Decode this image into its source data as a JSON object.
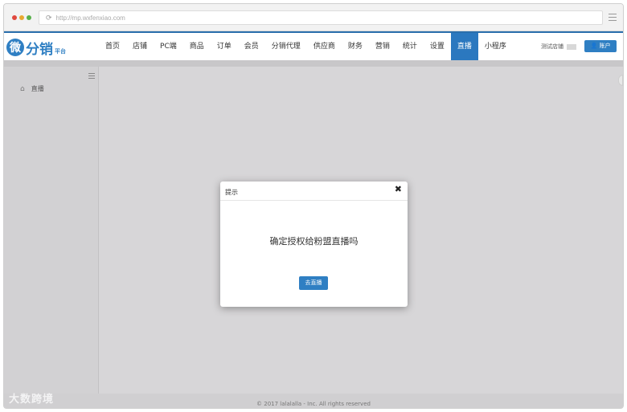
{
  "browser": {
    "url": "http://mp.wxfenxiao.com"
  },
  "logo": {
    "badge": "微",
    "name": "分销",
    "sub": "平台"
  },
  "nav": {
    "items": [
      "首页",
      "店铺",
      "PC端",
      "商品",
      "订单",
      "会员",
      "分销代理",
      "供应商",
      "财务",
      "营销",
      "统计",
      "设置",
      "直播",
      "小程序"
    ],
    "active_index": 12
  },
  "header_right": {
    "shop_label": "测试店铺",
    "account_label": "账户"
  },
  "sidebar": {
    "item_label": "直播"
  },
  "modal": {
    "title": "提示",
    "close": "✖",
    "message": "确定授权给粉盟直播吗",
    "button_label": "去直播"
  },
  "footer": {
    "text": "© 2017 lalalalla - Inc. All rights reserved"
  },
  "watermark": {
    "text": "大数跨境"
  },
  "colors": {
    "primary": "#2f7fc3",
    "active_nav": "#2b78bf"
  }
}
